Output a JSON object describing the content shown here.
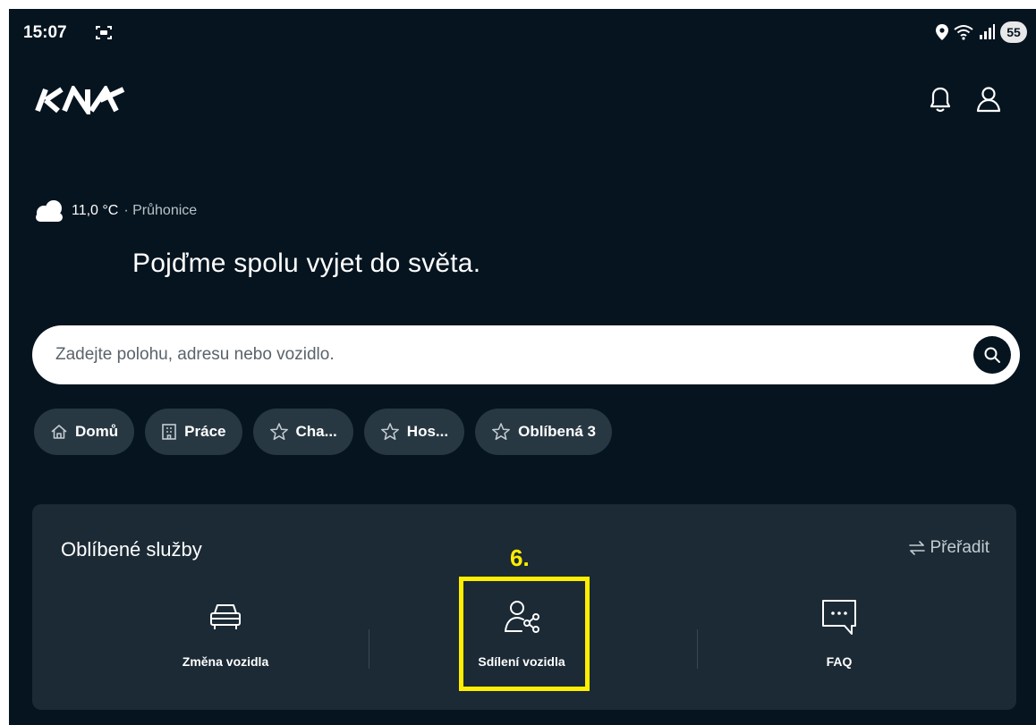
{
  "status_bar": {
    "time": "15:07",
    "battery": "55"
  },
  "weather": {
    "temperature": "11,0 °C",
    "location": "· Průhonice"
  },
  "greeting": "Pojďme spolu vyjet do světa.",
  "search": {
    "placeholder": "Zadejte polohu, adresu nebo vozidlo."
  },
  "chips": [
    {
      "label": "Domů",
      "icon": "home-icon"
    },
    {
      "label": "Práce",
      "icon": "building-icon"
    },
    {
      "label": "Cha...",
      "icon": "star-icon"
    },
    {
      "label": "Hos...",
      "icon": "star-icon"
    },
    {
      "label": "Oblíbená 3",
      "icon": "star-icon"
    }
  ],
  "services": {
    "title": "Oblíbené služby",
    "reorder_label": "Přeřadit",
    "items": [
      {
        "label": "Změna vozidla",
        "icon": "car-icon"
      },
      {
        "label": "Sdílení vozidla",
        "icon": "share-vehicle-icon"
      },
      {
        "label": "FAQ",
        "icon": "faq-icon"
      }
    ]
  },
  "annotation": {
    "label": "6.",
    "color": "#ffee00"
  },
  "colors": {
    "background": "#05141f",
    "card": "#1b2a35",
    "chip": "#283843"
  }
}
